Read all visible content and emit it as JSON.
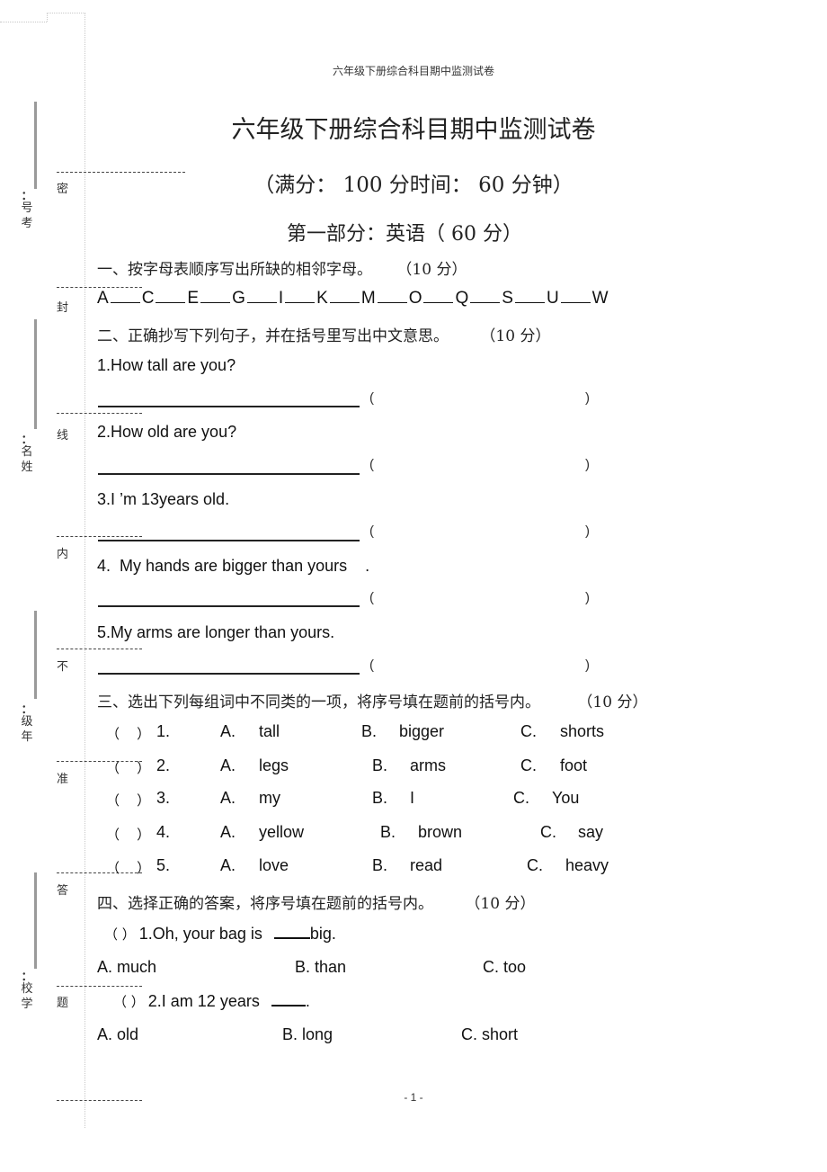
{
  "header": "六年级下册综合科目期中监测试卷",
  "title": "六年级下册综合科目期中监测试卷",
  "subtitle": "（满分： 100 分时间： 60 分钟）",
  "part_title": "第一部分：英语（ 60 分）",
  "binding_margin": {
    "seal_words": [
      "密",
      "封",
      "线",
      "内",
      "不",
      "准",
      "答",
      "题"
    ],
    "fields": [
      {
        "label": "号考",
        "colon": "："
      },
      {
        "label": "名姓",
        "colon": "："
      },
      {
        "label": "级年",
        "colon": "："
      },
      {
        "label": "校学",
        "colon": "："
      }
    ]
  },
  "section1": {
    "heading": "一、按字母表顺序写出所缺的相邻字母。",
    "score": "（10 分）",
    "letters": [
      "A",
      "C",
      "E",
      "G",
      "I",
      "K",
      "M",
      "O",
      "Q",
      "S",
      "U",
      "W"
    ]
  },
  "section2": {
    "heading": "二、正确抄写下列句子，并在括号里写出中文意思。",
    "score": "（10 分）",
    "paren_open": "(",
    "paren_close": ")",
    "sentences": [
      "1.How tall are you?",
      "2.How old are you?",
      "3.I ’m 13years old.",
      "4.  My hands are bigger than yours    .",
      "5.My arms are longer than yours."
    ]
  },
  "section3": {
    "heading": "三、选出下列每组词中不同类的一项，将序号填在题前的括号内。",
    "score": "（10 分）",
    "paren": "（    ）",
    "questions": [
      {
        "num": "1.",
        "a": "A.",
        "a_word": "tall",
        "b": "B.",
        "b_word": "bigger",
        "c": "C.",
        "c_word": "shorts"
      },
      {
        "num": "2.",
        "a": "A.",
        "a_word": "legs",
        "b": "B.",
        "b_word": "arms",
        "c": "C.",
        "c_word": "foot"
      },
      {
        "num": "3.",
        "a": "A.",
        "a_word": "my",
        "b": "B.",
        "b_word": "I",
        "c": "C.",
        "c_word": "You"
      },
      {
        "num": "4.",
        "a": "A.",
        "a_word": "yellow",
        "b": "B.",
        "b_word": "brown",
        "c": "C.",
        "c_word": "say"
      },
      {
        "num": "5.",
        "a": "A.",
        "a_word": "love",
        "b": "B.",
        "b_word": "read",
        "c": "C.",
        "c_word": "heavy"
      }
    ]
  },
  "section4": {
    "heading": "四、选择正确的答案，将序号填在题前的括号内。",
    "score": "（10 分）",
    "paren": "（    ）",
    "questions": [
      {
        "stem_before": "1.Oh, your bag is",
        "stem_after": "big.",
        "options": [
          "A. much",
          "B. than",
          "C. too"
        ]
      },
      {
        "stem_before": "2.I am 12 years",
        "stem_after": ".",
        "options": [
          "A. old",
          "B. long",
          "C. short"
        ]
      }
    ]
  },
  "footer": "- 1 -"
}
